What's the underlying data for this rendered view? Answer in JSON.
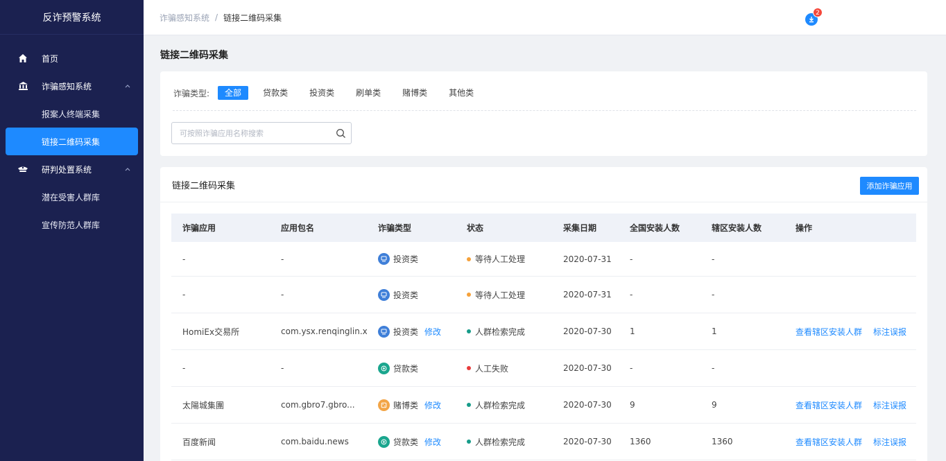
{
  "app": {
    "title": "反诈预警系统"
  },
  "sidebar": {
    "items": [
      {
        "label": "首页",
        "icon": "home-icon"
      },
      {
        "label": "诈骗感知系统",
        "icon": "bank-icon",
        "children": [
          {
            "label": "报案人终端采集"
          },
          {
            "label": "链接二维码采集",
            "active": true
          }
        ]
      },
      {
        "label": "研判处置系统",
        "icon": "police-cap-icon",
        "children": [
          {
            "label": "潜在受害人群库"
          },
          {
            "label": "宣传防范人群库"
          }
        ]
      }
    ]
  },
  "header": {
    "breadcrumb": [
      "诈骗感知系统",
      "链接二维码采集"
    ],
    "notification_count": "2"
  },
  "page": {
    "title": "链接二维码采集"
  },
  "filter": {
    "type_label": "诈骗类型:",
    "types": [
      "全部",
      "贷款类",
      "投资类",
      "刷单类",
      "赌博类",
      "其他类"
    ],
    "active_type": "全部",
    "search_placeholder": "可按照诈骗应用名称搜索"
  },
  "table": {
    "title": "链接二维码采集",
    "add_button": "添加诈骗应用",
    "columns": [
      "诈骗应用",
      "应用包名",
      "诈骗类型",
      "状态",
      "采集日期",
      "全国安装人数",
      "辖区安装人数",
      "操作"
    ],
    "rows": [
      {
        "app": "-",
        "package": "-",
        "type": "投资类",
        "type_icon": "investment-icon",
        "type_color": "#3f7fd8",
        "edit": "",
        "status": "等待人工处理",
        "status_color": "#f5a13a",
        "date": "2020-07-31",
        "national": "-",
        "regional": "-",
        "ops": []
      },
      {
        "app": "-",
        "package": "-",
        "type": "投资类",
        "type_icon": "investment-icon",
        "type_color": "#3f7fd8",
        "edit": "",
        "status": "等待人工处理",
        "status_color": "#f5a13a",
        "date": "2020-07-31",
        "national": "-",
        "regional": "-",
        "ops": []
      },
      {
        "app": "HomiEx交易所",
        "package": "com.ysx.renqinglin.xzi...",
        "type": "投资类",
        "type_icon": "investment-icon",
        "type_color": "#3f7fd8",
        "edit": "修改",
        "status": "人群检索完成",
        "status_color": "#179c8a",
        "date": "2020-07-30",
        "national": "1",
        "regional": "1",
        "ops": [
          "查看辖区安装人群",
          "标注误报"
        ]
      },
      {
        "app": "-",
        "package": "-",
        "type": "贷款类",
        "type_icon": "loan-icon",
        "type_color": "#1aa68e",
        "edit": "",
        "status": "人工失败",
        "status_color": "#e83b3b",
        "date": "2020-07-30",
        "national": "-",
        "regional": "-",
        "ops": []
      },
      {
        "app": "太陽城集團",
        "package": "com.gbro7.gbro...",
        "type": "赌博类",
        "type_icon": "gamble-icon",
        "type_color": "#f2a547",
        "edit": "修改",
        "status": "人群检索完成",
        "status_color": "#179c8a",
        "date": "2020-07-30",
        "national": "9",
        "regional": "9",
        "ops": [
          "查看辖区安装人群",
          "标注误报"
        ]
      },
      {
        "app": "百度新闻",
        "package": "com.baidu.news",
        "type": "贷款类",
        "type_icon": "loan-icon",
        "type_color": "#1aa68e",
        "edit": "修改",
        "status": "人群检索完成",
        "status_color": "#179c8a",
        "date": "2020-07-30",
        "national": "1360",
        "regional": "1360",
        "ops": [
          "查看辖区安装人群",
          "标注误报"
        ]
      }
    ]
  }
}
